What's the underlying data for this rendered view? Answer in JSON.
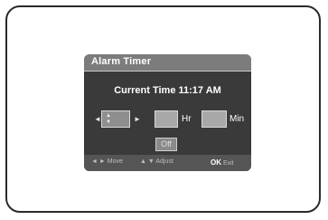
{
  "dialog": {
    "title": "Alarm Timer",
    "current_time_label": "Current Time 11:17 AM",
    "hour_value": "",
    "hour_unit": "Hr",
    "minute_value": "",
    "minute_unit": "Min",
    "off_label": "Off"
  },
  "hints": {
    "move_keys": "◄ ►",
    "move_label": "Move",
    "adjust_keys": "▲ ▼",
    "adjust_label": "Adjust",
    "ok_key": "OK",
    "exit_label": "Exit"
  },
  "icons": {
    "left_arrow": "◄",
    "right_arrow": "►",
    "up_arrow": "▲",
    "down_arrow": "▼"
  }
}
